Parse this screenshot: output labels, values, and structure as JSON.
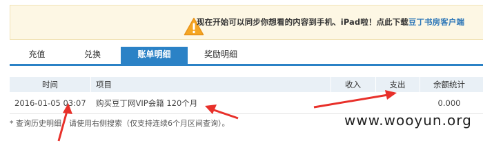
{
  "notice": {
    "icon": "warning-icon",
    "text": "现在开始可以同步你想看的内容到手机、iPad啦！点此下载",
    "link_text": "豆丁书房客户端",
    "colors": {
      "background": "#fdf7e4",
      "icon": "#f5a623",
      "link": "#2f78b8"
    }
  },
  "tabs": [
    {
      "label": "充值",
      "active": false
    },
    {
      "label": "兑换",
      "active": false
    },
    {
      "label": "账单明细",
      "active": true
    },
    {
      "label": "奖励明细",
      "active": false
    }
  ],
  "table": {
    "headers": {
      "time": "时间",
      "item": "项目",
      "income": "收入",
      "expense": "支出",
      "balance": "余额统计"
    },
    "rows": [
      {
        "time": "2016-01-05 03:07",
        "item": "购买豆丁网VIP会籍 120个月",
        "income": "",
        "expense": "",
        "balance": "0.000"
      }
    ]
  },
  "hint": "* 查询历史明细，请使用右侧搜索（仅支持连续6个月区间查询）。",
  "watermark": "www.wooyun.org",
  "accent_color": "#2b82c6",
  "annotation_color": "#e8302a"
}
